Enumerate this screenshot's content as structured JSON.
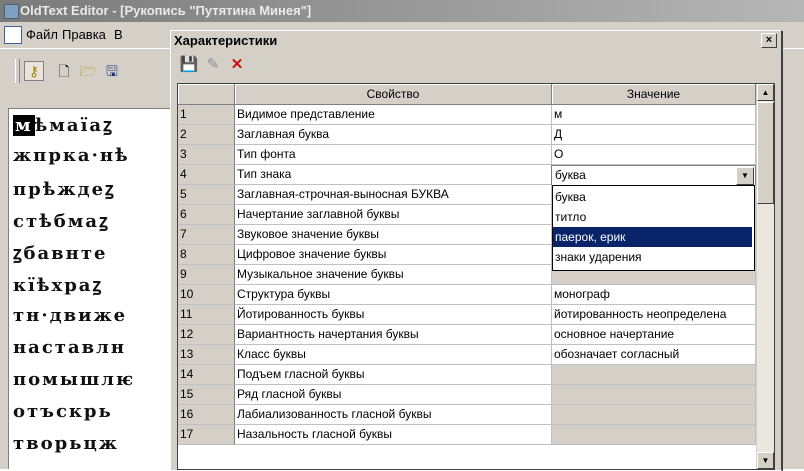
{
  "app": {
    "title": "OldText Editor - [Рукопись \"Путятина Минея\"]",
    "menu": [
      "Файл",
      "Правка",
      "В"
    ],
    "text_lines": [
      "мѣмаїаꙁ",
      "жпрка·нѣ",
      "прѣждеꙁ",
      "стѣбмаꙁ",
      "ꙁбавнте",
      "кїѣхраꙁ",
      "тн·движе",
      "наставлн",
      "помышлѥ",
      "отъскрь",
      "творьцж"
    ]
  },
  "dialog": {
    "title": "Характеристики",
    "close": "×",
    "tools": {
      "save": "💾",
      "edit": "✎",
      "delete": "✕"
    },
    "columns": {
      "property": "Свойство",
      "value": "Значение"
    },
    "rows": [
      {
        "n": "1",
        "prop": "Видимое представление",
        "val": "м",
        "grey": false
      },
      {
        "n": "2",
        "prop": "Заглавная буква",
        "val": "Д",
        "grey": false
      },
      {
        "n": "3",
        "prop": "Тип фонта",
        "val": "О",
        "grey": false
      },
      {
        "n": "4",
        "prop": "Тип знака",
        "val": "",
        "grey": false
      },
      {
        "n": "5",
        "prop": "Заглавная-строчная-выносная БУКВА",
        "val": "",
        "grey": false
      },
      {
        "n": "6",
        "prop": "Начертание заглавной буквы",
        "val": "",
        "grey": false
      },
      {
        "n": "7",
        "prop": "Звуковое значение буквы",
        "val": "",
        "grey": false
      },
      {
        "n": "8",
        "prop": "Цифровое значение буквы",
        "val": "",
        "grey": false
      },
      {
        "n": "9",
        "prop": "Музыкальное значение буквы",
        "val": "",
        "grey": true
      },
      {
        "n": "10",
        "prop": "Структура буквы",
        "val": "монограф",
        "grey": false
      },
      {
        "n": "11",
        "prop": "Йотированность  буквы",
        "val": "йотированность неопределена",
        "grey": false
      },
      {
        "n": "12",
        "prop": "Вариантность начертания буквы",
        "val": "основное начертание",
        "grey": false
      },
      {
        "n": "13",
        "prop": "Класс буквы",
        "val": "обозначает согласный",
        "grey": false
      },
      {
        "n": "14",
        "prop": "Подъем гласной буквы",
        "val": "",
        "grey": true
      },
      {
        "n": "15",
        "prop": "Ряд гласной буквы",
        "val": "",
        "grey": true
      },
      {
        "n": "16",
        "prop": "Лабиализованность гласной буквы",
        "val": "",
        "grey": true
      },
      {
        "n": "17",
        "prop": "Назальность гласной буквы",
        "val": "",
        "grey": true
      }
    ],
    "combo_value": "буква",
    "dropdown_options": [
      "буква",
      "титло",
      "паерок, ерик",
      "знаки ударения"
    ],
    "dropdown_selected": 2
  }
}
